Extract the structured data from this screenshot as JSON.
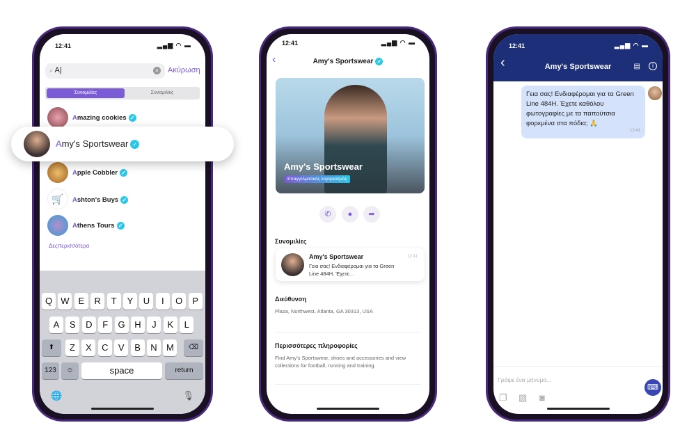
{
  "colors": {
    "accent": "#7b5bd6",
    "verified": "#2cc6e6",
    "chat_header": "#1e2f7a",
    "bubble": "#d4e3fb"
  },
  "time": "12:41",
  "search": {
    "value": "A|",
    "cancel": "Ακύρωση",
    "tabs": [
      "Συνομιλίες",
      "Συνομιλίες"
    ],
    "results": [
      {
        "initial": "A",
        "rest": "mazing cookies"
      },
      {
        "initial": "A",
        "rest": "my's Sportswear"
      },
      {
        "initial": "A",
        "rest": "pple Cobbler"
      },
      {
        "initial": "A",
        "rest": "shton's Buys"
      },
      {
        "initial": "A",
        "rest": "thens Tours"
      }
    ],
    "more": "Δεςπερισσότερα"
  },
  "keyboard": {
    "row1": [
      "Q",
      "W",
      "E",
      "R",
      "T",
      "Y",
      "U",
      "I",
      "O",
      "P"
    ],
    "row2": [
      "A",
      "S",
      "D",
      "F",
      "G",
      "H",
      "J",
      "K",
      "L"
    ],
    "row3": [
      "Z",
      "X",
      "C",
      "V",
      "B",
      "N",
      "M"
    ],
    "shift": "⬆",
    "backspace": "⌫",
    "numbers": "123",
    "emoji": "☺",
    "space": "space",
    "return": "return",
    "globe": "🌐",
    "mic": "🎙"
  },
  "profile": {
    "title": "Amy's Sportswear",
    "hero_name": "Amy's Sportswear",
    "badge": "Επαγγελματικός λογαριασμός",
    "actions": [
      "call-icon",
      "globe-icon",
      "share-icon"
    ],
    "chats_heading": "Συνομιλίες",
    "chat_name": "Amy's Sportswear",
    "chat_time": "12:41",
    "chat_preview": "Γεια σας! Ενδιαφέρομαι για τα Green Line 484H. Έχετε...",
    "address_heading": "Διεύθυνση",
    "address": "Plaza, Northwest, Atlanta, GA 30313, USA",
    "info_heading": "Περισσότερες πληροφορίες",
    "info": "Find Amy's Sportswear, shoes and accessories and view collections for football, running and training."
  },
  "chat": {
    "title": "Amy's Sportswear",
    "message": "Γεια σας! Ενδιαφέρομαι για τα Green Line 484H. Έχετε καθόλου φωτογραφίες με τα παπούτσια φορεμένα στα πόδια; 🙏",
    "message_time": "12:41",
    "placeholder": "Γράψε ένα μήνυμα..."
  }
}
